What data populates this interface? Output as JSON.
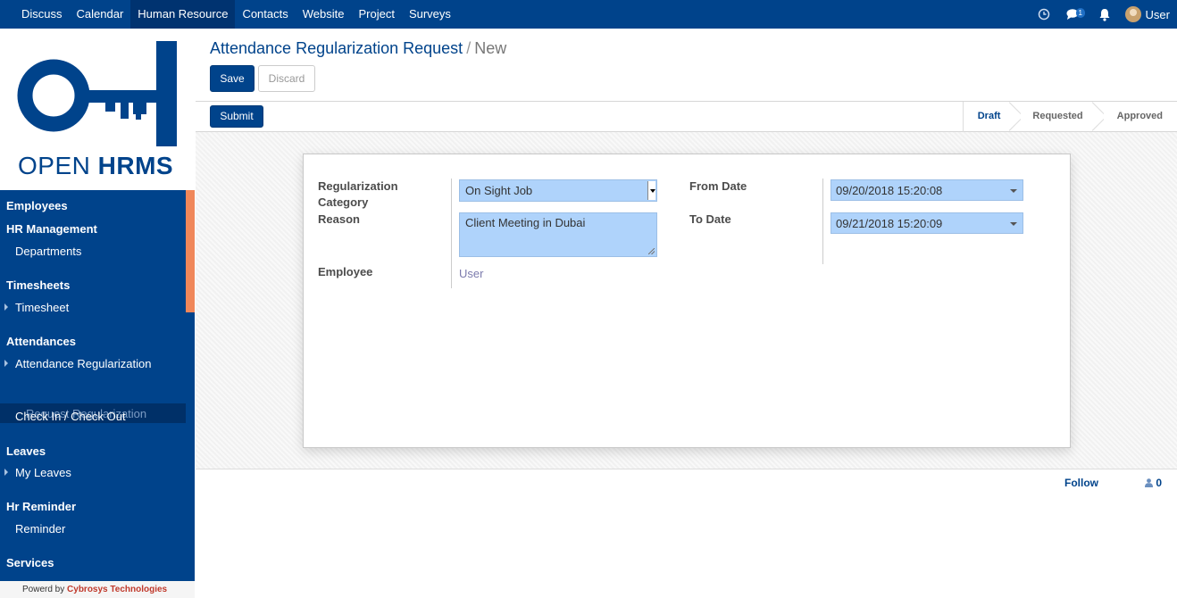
{
  "topnav": {
    "menu": [
      "Discuss",
      "Calendar",
      "Human Resource",
      "Contacts",
      "Website",
      "Project",
      "Surveys"
    ],
    "active_index": 2,
    "message_count": "1",
    "user": "User"
  },
  "logo": {
    "light": "OPEN ",
    "bold": "HRMS"
  },
  "sidebar": {
    "employees": "Employees",
    "hr_management": "HR Management",
    "departments": "Departments",
    "timesheets": "Timesheets",
    "timesheet": "Timesheet",
    "attendances": "Attendances",
    "attendance_regularization": "Attendance Regularization",
    "request_regularization": "Request Regularization",
    "check_in_out": "Check In / Check Out",
    "leaves": "Leaves",
    "my_leaves": "My Leaves",
    "hr_reminder": "Hr Reminder",
    "reminder": "Reminder",
    "services": "Services",
    "powered_prefix": "Powerd by ",
    "powered_brand": "Cybrosys Technologies"
  },
  "breadcrumb": {
    "parent": "Attendance Regularization Request",
    "separator": "/",
    "current": "New"
  },
  "buttons": {
    "save": "Save",
    "discard": "Discard",
    "submit": "Submit"
  },
  "stages": [
    "Draft",
    "Requested",
    "Approved"
  ],
  "active_stage": "Draft",
  "form": {
    "regularization_category_label": "Regularization Category",
    "regularization_category_value": "On Sight Job",
    "reason_label": "Reason",
    "reason_value": "Client Meeting in Dubai",
    "employee_label": "Employee",
    "employee_value": "User",
    "from_date_label": "From Date",
    "from_date_value": "09/20/2018 15:20:08",
    "to_date_label": "To Date",
    "to_date_value": "09/21/2018 15:20:09"
  },
  "chatter": {
    "follow": "Follow",
    "followers_count": "0"
  },
  "colors": {
    "brand": "#00438b",
    "field_bg": "#afd3fb",
    "accent_scroll": "#f0875a"
  }
}
